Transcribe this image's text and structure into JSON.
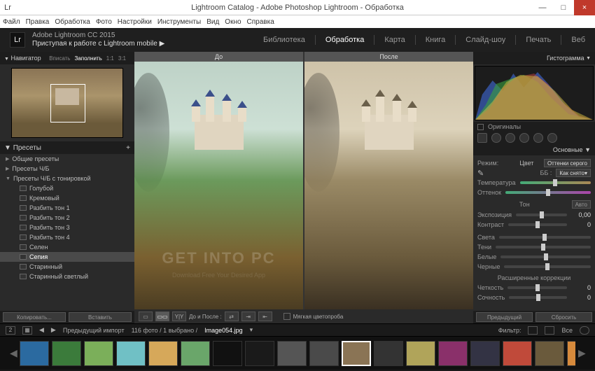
{
  "window": {
    "title": "Lightroom Catalog - Adobe Photoshop Lightroom - Обработка",
    "min": "—",
    "max": "□",
    "close": "×",
    "icon": "Lr"
  },
  "menubar": [
    "Файл",
    "Правка",
    "Обработка",
    "Фото",
    "Настройки",
    "Инструменты",
    "Вид",
    "Окно",
    "Справка"
  ],
  "brand": {
    "version": "Adobe Lightroom CC 2015",
    "mobile": "Приступая к работе с Lightroom mobile",
    "tri": "▶"
  },
  "modules": {
    "items": [
      "Библиотека",
      "Обработка",
      "Карта",
      "Книга",
      "Слайд-шоу",
      "Печать",
      "Веб"
    ],
    "active_index": 1
  },
  "left": {
    "navigator": {
      "title": "Навигатор",
      "fit": "Вписать",
      "fill": "Заполнить",
      "r1": "1:1",
      "r3": "3:1",
      "tri": "▼"
    },
    "presets": {
      "title": "Пресеты",
      "plus": "+",
      "folders": [
        {
          "label": "Общие пресеты",
          "open": false
        },
        {
          "label": "Пресеты Ч/Б",
          "open": false
        },
        {
          "label": "Пресеты Ч/Б с тонировкой",
          "open": true
        }
      ],
      "items": [
        "Голубой",
        "Кремовый",
        "Разбить тон 1",
        "Разбить тон 2",
        "Разбить тон 3",
        "Разбить тон 4",
        "Селен",
        "Сепия",
        "Старинный",
        "Старинный светлый"
      ],
      "selected_index": 7
    },
    "footer": {
      "copy": "Копировать...",
      "paste": "Вставить"
    }
  },
  "center": {
    "before": "До",
    "after": "После",
    "watermark": "GET INTO PC",
    "watermark_sub": "Download Free Your Desired App",
    "toolbar": {
      "label_ba": "До и После :",
      "softproof": "Мягкая цветопроба"
    }
  },
  "right": {
    "histogram": {
      "title": "Гистограмма",
      "tri": "▼"
    },
    "originals": "Оригиналы",
    "basic": {
      "title": "Основные",
      "tri": "▼",
      "mode_label": "Режим:",
      "mode_color": "Цвет",
      "mode_gray": "Оттенки серого",
      "wb_label": "ББ :",
      "wb_as_shot": "Как снято",
      "wb_tri": "▾",
      "temp_label": "Температура",
      "tint_label": "Оттенок",
      "tone_title": "Тон",
      "auto": "Авто",
      "exposure_label": "Экспозиция",
      "exposure_val": "0,00",
      "contrast_label": "Контраст",
      "contrast_val": "0",
      "highlights_label": "Света",
      "shadows_label": "Тени",
      "whites_label": "Белые",
      "blacks_label": "Черные",
      "adv_title": "Расширенные коррекции",
      "clarity_label": "Четкость",
      "clarity_val": "0",
      "saturation_label": "Сочность",
      "saturation_val": "0"
    },
    "footer": {
      "prev": "Предыдущий",
      "reset": "Сбросить"
    }
  },
  "infobar": {
    "prev_import": "Предыдущий импорт",
    "counts": "116 фото / 1 выбрано /",
    "filename": "Image054.jpg",
    "filter": "Фильтр:",
    "off": "Все"
  },
  "filmstrip": {
    "colors": [
      "#2b6aa0",
      "#3b7b3b",
      "#7baf5a",
      "#70c0c5",
      "#d6a85a",
      "#6aa66a",
      "#111",
      "#1a1a1a",
      "#555",
      "#4a4a4a",
      "#8a7455",
      "#333",
      "#b0a45a",
      "#8a306a",
      "#334",
      "#c04a3a",
      "#6a5a3c",
      "#d68a3c"
    ],
    "selected_index": 10
  }
}
